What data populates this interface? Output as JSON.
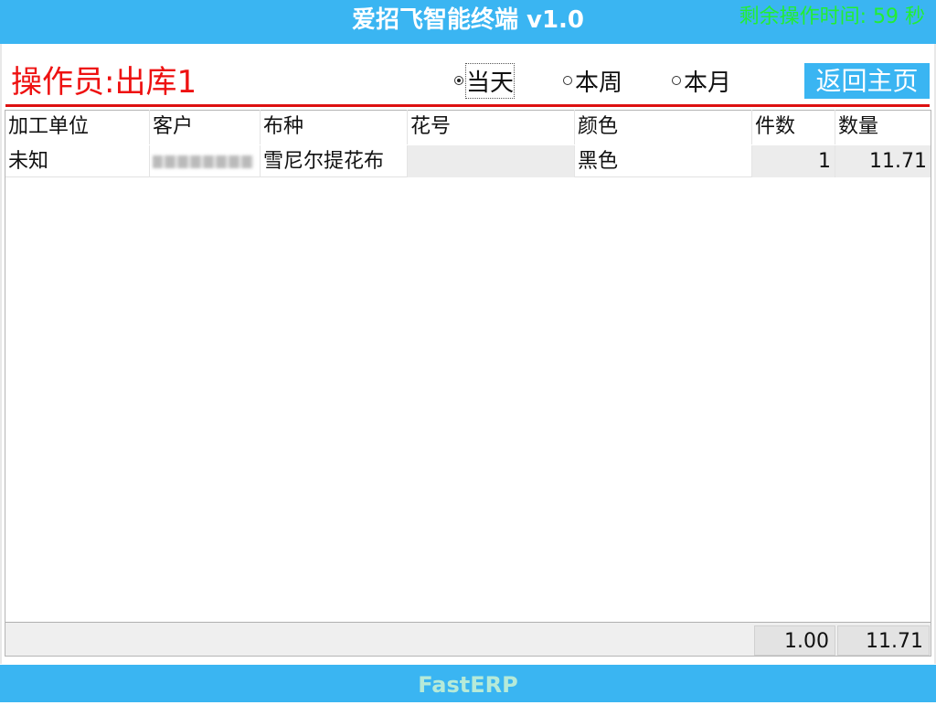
{
  "header": {
    "title": "爱招飞智能终端 v1.0",
    "timer_text": "剩余操作时间: 59 秒"
  },
  "operator": {
    "label": "操作员:出库1"
  },
  "period_filter": {
    "options": [
      {
        "label": "当天",
        "checked": true
      },
      {
        "label": "本周",
        "checked": false
      },
      {
        "label": "本月",
        "checked": false
      }
    ]
  },
  "home_button": {
    "label": "返回主页"
  },
  "grid": {
    "columns": [
      "加工单位",
      "客户",
      "布种",
      "花号",
      "颜色",
      "件数",
      "数量"
    ],
    "rows": [
      {
        "processing_unit": "未知",
        "customer": "",
        "fabric": "雪尼尔提花布",
        "pattern_no": "",
        "color": "黑色",
        "pieces": "1",
        "quantity": "11.71"
      }
    ],
    "totals": {
      "pieces": "1.00",
      "quantity": "11.71"
    }
  },
  "footer": {
    "brand": "FastERP"
  },
  "colors": {
    "header_bg": "#3ab5f2",
    "timer": "#22ee33",
    "operator": "#ee1111",
    "footer_text": "#b6ead8"
  }
}
